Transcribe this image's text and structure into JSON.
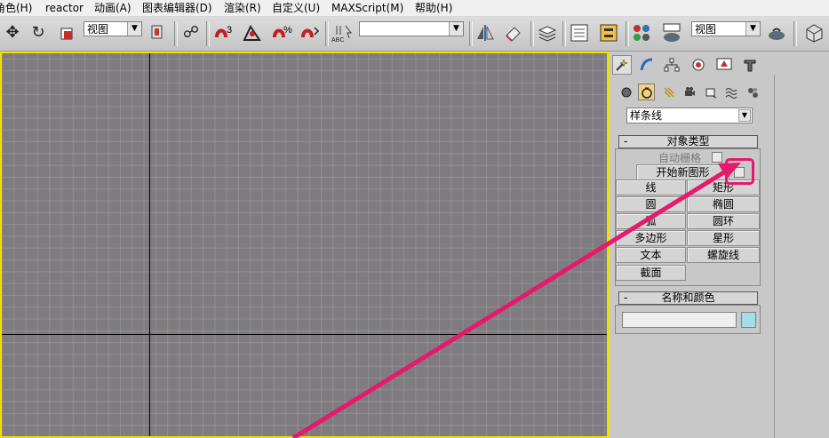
{
  "menubar": {
    "items": [
      "角色(H)",
      "reactor",
      "动画(A)",
      "图表编辑器(D)",
      "渲染(R)",
      "自定义(U)",
      "MAXScript(M)",
      "帮助(H)"
    ]
  },
  "toolbar": {
    "view_dropdown_1": "视图",
    "named_selection_dropdown": "",
    "view_dropdown_2": "视图",
    "spinner_snap_label": "ABC",
    "snap_3_label": "3",
    "percent_snap_label": "%"
  },
  "command_panel": {
    "category_dropdown": "样条线",
    "rollout_object_type": {
      "title": "对象类型",
      "collapse_sign": "-",
      "autogrid_label": "自动栅格",
      "start_new_shape_label": "开始新图形",
      "start_new_shape_checked": false,
      "buttons": [
        [
          "线",
          "矩形"
        ],
        [
          "圆",
          "椭圆"
        ],
        [
          "弧",
          "圆环"
        ],
        [
          "多边形",
          "星形"
        ],
        [
          "文本",
          "螺旋线"
        ],
        [
          "截面",
          ""
        ]
      ]
    },
    "rollout_name_color": {
      "title": "名称和颜色",
      "collapse_sign": "-",
      "name_value": "",
      "swatch_color": "#a6dce8"
    }
  },
  "colors": {
    "viewport_bg": "#7f7b80",
    "viewport_border": "#f0e000",
    "annotation": "#e6196a"
  }
}
